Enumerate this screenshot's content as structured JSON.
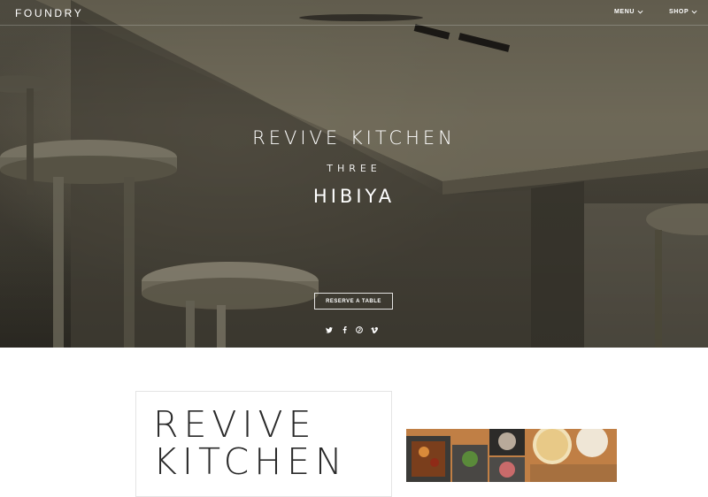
{
  "nav": {
    "logo": "FOUNDRY",
    "menu_label": "MENU",
    "shop_label": "SHOP"
  },
  "hero": {
    "title": "REVIVE KITCHEN",
    "subtitle": "THREE",
    "location": "HIBIYA",
    "cta_label": "RESERVE A TABLE",
    "social_icons": [
      "twitter-icon",
      "facebook-icon",
      "pinterest-icon",
      "vimeo-icon"
    ]
  },
  "intro": {
    "heading": "REVIVE KITCHEN"
  },
  "colors": {
    "hero_tone": "#4c483d",
    "text_light": "#ffffff",
    "text_dark": "#2a2a2a"
  }
}
